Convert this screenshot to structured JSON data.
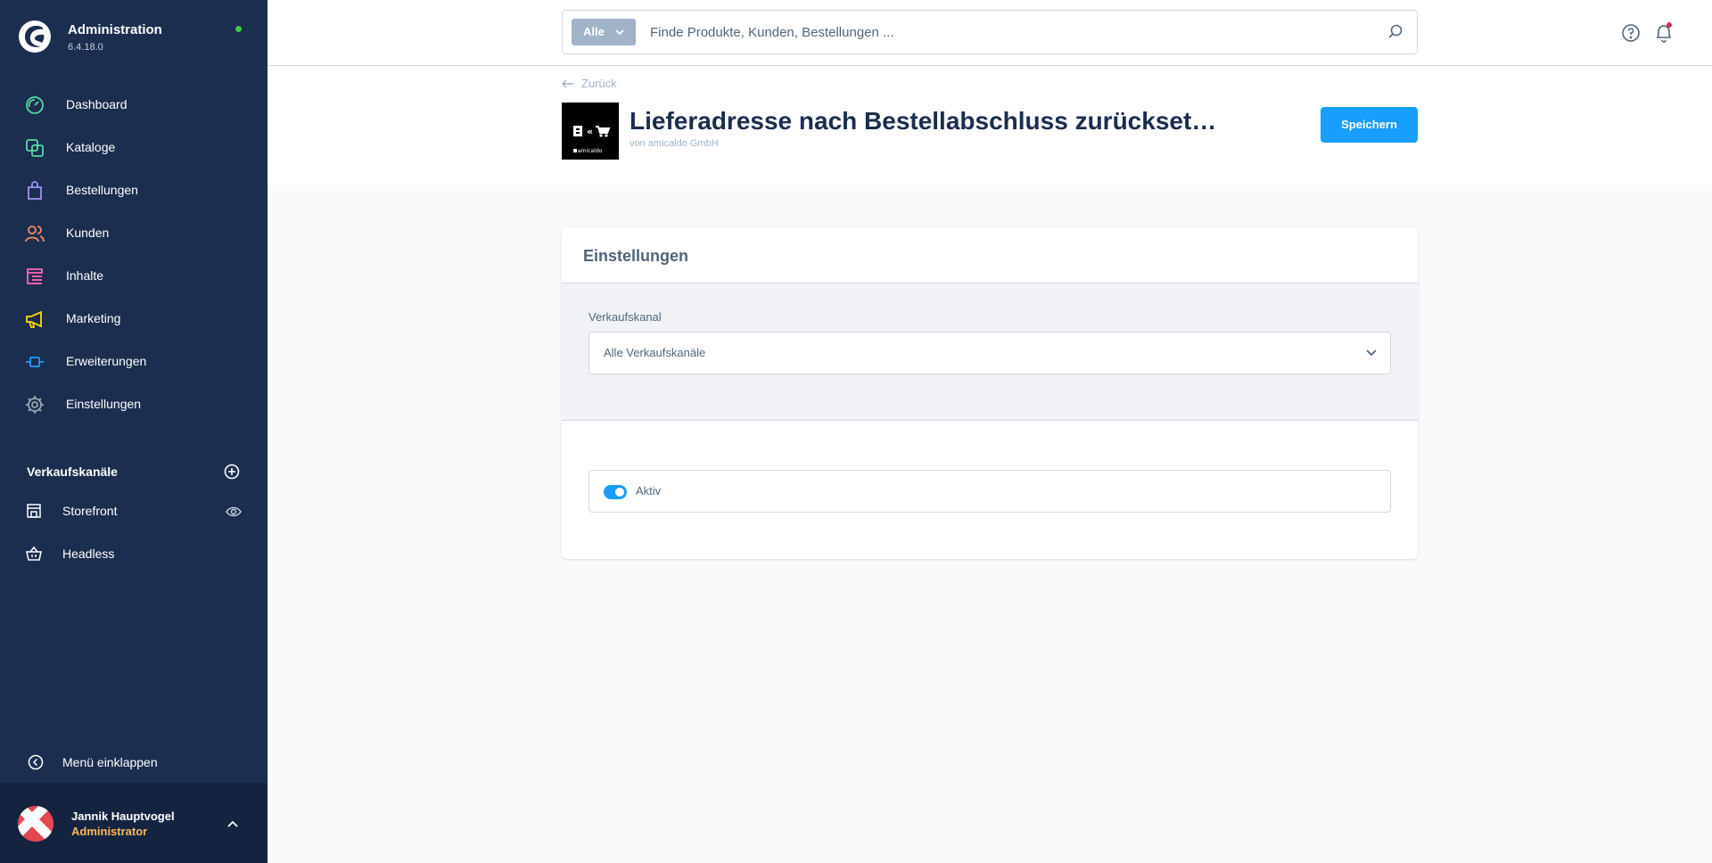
{
  "app": {
    "title": "Administration",
    "version": "6.4.18.0",
    "status_color": "#37d046"
  },
  "sidebar": {
    "items": [
      {
        "label": "Dashboard",
        "icon": "dashboard-icon",
        "color": "#57d9a3"
      },
      {
        "label": "Kataloge",
        "icon": "catalog-icon",
        "color": "#57d9a3"
      },
      {
        "label": "Bestellungen",
        "icon": "bag-icon",
        "color": "#a092f0"
      },
      {
        "label": "Kunden",
        "icon": "users-icon",
        "color": "#f88962"
      },
      {
        "label": "Inhalte",
        "icon": "content-icon",
        "color": "#ff68b4"
      },
      {
        "label": "Marketing",
        "icon": "megaphone-icon",
        "color": "#ffd700"
      },
      {
        "label": "Erweiterungen",
        "icon": "plug-icon",
        "color": "#189eff"
      },
      {
        "label": "Einstellungen",
        "icon": "gear-icon",
        "color": "#9aa8b5"
      }
    ],
    "sales_channels_title": "Verkaufskanäle",
    "channels": [
      {
        "label": "Storefront",
        "icon": "storefront-icon"
      },
      {
        "label": "Headless",
        "icon": "basket-icon"
      }
    ],
    "collapse_label": "Menü einklappen",
    "user": {
      "name": "Jannik Hauptvogel",
      "role": "Administrator"
    }
  },
  "search": {
    "type_label": "Alle",
    "placeholder": "Finde Produkte, Kunden, Bestellungen ..."
  },
  "header": {
    "back_label": "Zurück",
    "title": "Lieferadresse nach Bestellabschluss zurückset…",
    "subtitle": "von amicaldo GmbH",
    "save_label": "Speichern",
    "logo_text": "amicaldo",
    "logo_glyph": "«"
  },
  "card": {
    "title": "Einstellungen",
    "sales_channel_label": "Verkaufskanal",
    "sales_channel_value": "Alle Verkaufskanäle",
    "active_label": "Aktiv",
    "active": true
  }
}
